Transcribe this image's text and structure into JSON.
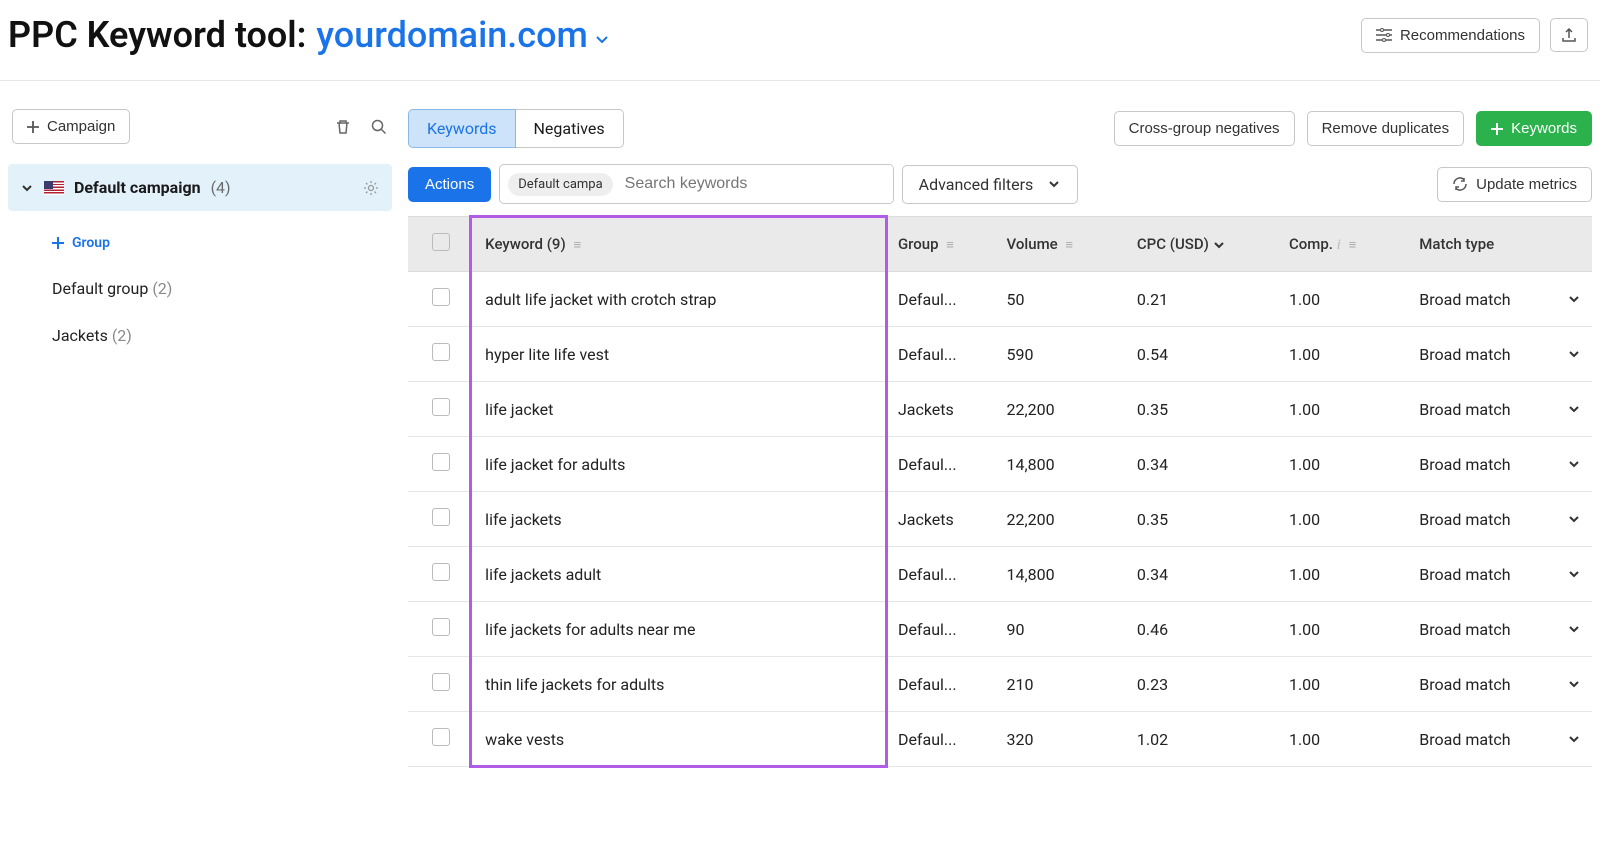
{
  "header": {
    "tool_label": "PPC Keyword tool:",
    "domain": "yourdomain.com",
    "recommendations_label": "Recommendations"
  },
  "sidebar": {
    "add_campaign_label": "Campaign",
    "campaign_name": "Default campaign",
    "campaign_count": "(4)",
    "add_group_label": "Group",
    "groups": [
      {
        "label": "Default group",
        "count": "(2)"
      },
      {
        "label": "Jackets",
        "count": "(2)"
      }
    ]
  },
  "tabs": {
    "keywords_label": "Keywords",
    "negatives_label": "Negatives"
  },
  "actions": {
    "cross_group_label": "Cross-group negatives",
    "remove_dup_label": "Remove duplicates",
    "add_keywords_label": "Keywords",
    "actions_btn_label": "Actions",
    "search_pill": "Default campa",
    "search_placeholder": "Search keywords",
    "adv_filters_label": "Advanced filters",
    "update_metrics_label": "Update metrics"
  },
  "table": {
    "headers": {
      "keyword": "Keyword (9)",
      "group": "Group",
      "volume": "Volume",
      "cpc": "CPC (USD)",
      "comp": "Comp.",
      "match": "Match type"
    },
    "rows": [
      {
        "keyword": "adult life jacket with crotch strap",
        "group": "Defaul...",
        "volume": "50",
        "cpc": "0.21",
        "comp": "1.00",
        "match": "Broad match"
      },
      {
        "keyword": "hyper lite life vest",
        "group": "Defaul...",
        "volume": "590",
        "cpc": "0.54",
        "comp": "1.00",
        "match": "Broad match"
      },
      {
        "keyword": "life jacket",
        "group": "Jackets",
        "volume": "22,200",
        "cpc": "0.35",
        "comp": "1.00",
        "match": "Broad match"
      },
      {
        "keyword": "life jacket for adults",
        "group": "Defaul...",
        "volume": "14,800",
        "cpc": "0.34",
        "comp": "1.00",
        "match": "Broad match"
      },
      {
        "keyword": "life jackets",
        "group": "Jackets",
        "volume": "22,200",
        "cpc": "0.35",
        "comp": "1.00",
        "match": "Broad match"
      },
      {
        "keyword": "life jackets adult",
        "group": "Defaul...",
        "volume": "14,800",
        "cpc": "0.34",
        "comp": "1.00",
        "match": "Broad match"
      },
      {
        "keyword": "life jackets for adults near me",
        "group": "Defaul...",
        "volume": "90",
        "cpc": "0.46",
        "comp": "1.00",
        "match": "Broad match"
      },
      {
        "keyword": "thin life jackets for adults",
        "group": "Defaul...",
        "volume": "210",
        "cpc": "0.23",
        "comp": "1.00",
        "match": "Broad match"
      },
      {
        "keyword": "wake vests",
        "group": "Defaul...",
        "volume": "320",
        "cpc": "1.02",
        "comp": "1.00",
        "match": "Broad match"
      }
    ]
  }
}
